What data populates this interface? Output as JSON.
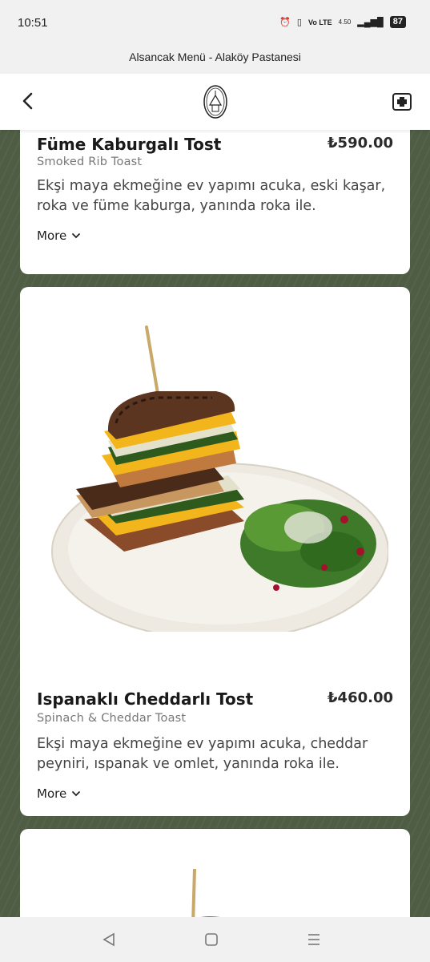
{
  "status": {
    "time": "10:51",
    "battery": "87",
    "network": "Vo LTE",
    "speed": "4.50"
  },
  "page": {
    "title": "Alsancak Menü - Alaköy Pastanesi"
  },
  "items": [
    {
      "name": "Füme Kaburgalı Tost",
      "price": "₺590.00",
      "subtitle": "Smoked Rib Toast",
      "description": "Ekşi maya ekmeğine ev yapımı acuka, eski kaşar, roka ve füme kaburga, yanında roka ile.",
      "more": "More"
    },
    {
      "name": "Ispanaklı Cheddarlı Tost",
      "price": "₺460.00",
      "subtitle": "Spinach & Cheddar Toast",
      "description": "Ekşi maya ekmeğine ev yapımı acuka, cheddar peyniri, ıspanak ve omlet, yanında roka ile.",
      "more": "More"
    }
  ],
  "icons": {
    "back": "chevron-left-icon",
    "logo": "bakery-logo-icon",
    "menu": "first-aid-menu-icon",
    "more": "chevron-down-icon"
  },
  "colors": {
    "background_green": "#4f5d45",
    "card": "#ffffff"
  }
}
